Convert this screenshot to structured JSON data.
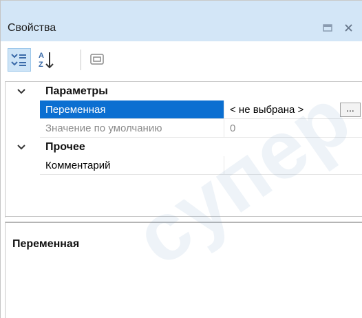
{
  "window": {
    "title": "Свойства",
    "controls": {
      "restore_icon": "window-restore-icon",
      "close_icon": "close-icon"
    }
  },
  "toolbar": {
    "buttons": [
      {
        "name": "categorized-view",
        "icon": "categorized-list-icon",
        "active": true
      },
      {
        "name": "alphabetical-sort",
        "icon": "sort-az-icon",
        "active": false
      },
      {
        "name": "property-pages",
        "icon": "property-pages-icon",
        "active": false
      }
    ]
  },
  "grid": {
    "categories": [
      {
        "label": "Параметры",
        "expanded": true,
        "properties": [
          {
            "name": "Переменная",
            "value": "< не выбрана >",
            "selected": true,
            "has_button": true,
            "button_label": "...",
            "readonly": false
          },
          {
            "name": "Значение по умолчанию",
            "value": "0",
            "selected": false,
            "readonly": true
          }
        ]
      },
      {
        "label": "Прочее",
        "expanded": true,
        "properties": [
          {
            "name": "Комментарий",
            "value": "",
            "selected": false,
            "readonly": false
          }
        ]
      }
    ]
  },
  "description": {
    "title": "Переменная"
  },
  "watermark": {
    "text": "супер"
  },
  "colors": {
    "title_bar": "#d3e6f7",
    "selection": "#0b6fd1",
    "muted_text": "#8a8a8a"
  }
}
